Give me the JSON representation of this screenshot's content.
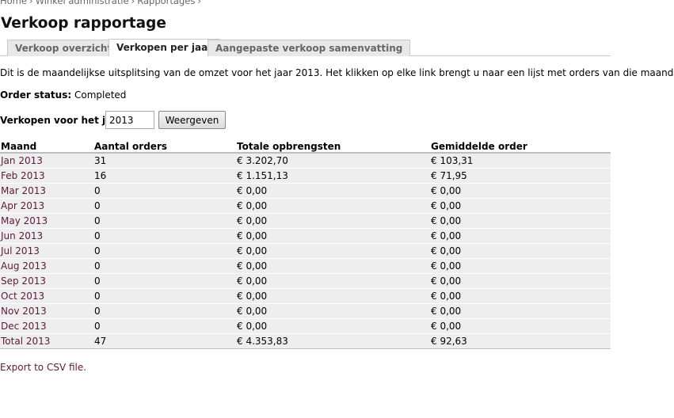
{
  "breadcrumb": {
    "items": [
      "Home",
      "Winkel administratie",
      "Rapportages"
    ],
    "separator": "›"
  },
  "page_title": "Verkoop rapportage",
  "tabs": [
    {
      "label": "Verkoop overzicht",
      "active": false
    },
    {
      "label": "Verkopen per jaar",
      "active": true
    },
    {
      "label": "Aangepaste verkoop samenvatting",
      "active": false
    }
  ],
  "intro_text": "Dit is de maandelijkse uitsplitsing van de omzet voor het jaar 2013. Het klikken op elke link brengt u naar een lijst met orders van die maand.",
  "order_status": {
    "label": "Order status:",
    "value": "Completed"
  },
  "year_form": {
    "label": "Verkopen voor het jaar:",
    "value": "2013",
    "button_label": "Weergeven"
  },
  "table": {
    "headers": [
      "Maand",
      "Aantal orders",
      "Totale opbrengsten",
      "Gemiddelde order"
    ],
    "rows": [
      {
        "month": "Jan 2013",
        "orders": "31",
        "revenue": "€ 3.202,70",
        "average": "€ 103,31"
      },
      {
        "month": "Feb 2013",
        "orders": "16",
        "revenue": "€ 1.151,13",
        "average": "€ 71,95"
      },
      {
        "month": "Mar 2013",
        "orders": "0",
        "revenue": "€ 0,00",
        "average": "€ 0,00"
      },
      {
        "month": "Apr 2013",
        "orders": "0",
        "revenue": "€ 0,00",
        "average": "€ 0,00"
      },
      {
        "month": "May 2013",
        "orders": "0",
        "revenue": "€ 0,00",
        "average": "€ 0,00"
      },
      {
        "month": "Jun 2013",
        "orders": "0",
        "revenue": "€ 0,00",
        "average": "€ 0,00"
      },
      {
        "month": "Jul 2013",
        "orders": "0",
        "revenue": "€ 0,00",
        "average": "€ 0,00"
      },
      {
        "month": "Aug 2013",
        "orders": "0",
        "revenue": "€ 0,00",
        "average": "€ 0,00"
      },
      {
        "month": "Sep 2013",
        "orders": "0",
        "revenue": "€ 0,00",
        "average": "€ 0,00"
      },
      {
        "month": "Oct 2013",
        "orders": "0",
        "revenue": "€ 0,00",
        "average": "€ 0,00"
      },
      {
        "month": "Nov 2013",
        "orders": "0",
        "revenue": "€ 0,00",
        "average": "€ 0,00"
      },
      {
        "month": "Dec 2013",
        "orders": "0",
        "revenue": "€ 0,00",
        "average": "€ 0,00"
      }
    ],
    "total": {
      "month": "Total 2013",
      "orders": "47",
      "revenue": "€ 4.353,83",
      "average": "€ 92,63"
    }
  },
  "export_link": "Export to CSV file.",
  "colors": {
    "link": "#5b1a3a",
    "row_bg": "#eeeeee",
    "tab_bg": "#e8e8e8"
  }
}
